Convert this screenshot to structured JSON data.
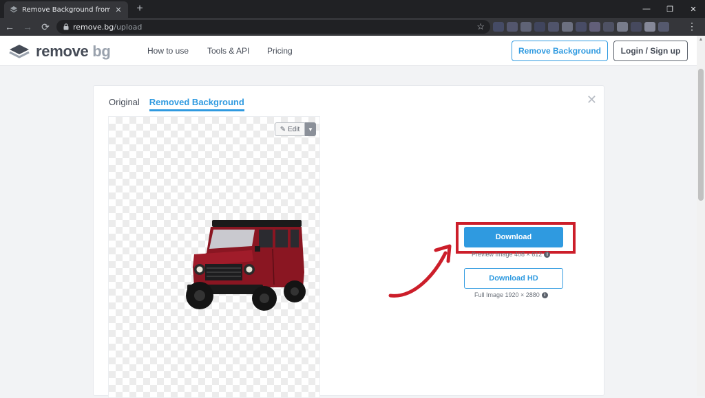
{
  "browser": {
    "tab_title": "Remove Background from Image",
    "tab_icon": "removebg-favicon",
    "url_domain": "remove.bg",
    "url_path": "/upload",
    "new_tab_glyph": "+",
    "close_tab_glyph": "✕"
  },
  "header": {
    "logo_remove": "remove",
    "logo_bg": "bg",
    "nav": [
      "How to use",
      "Tools & API",
      "Pricing"
    ],
    "remove_background_button": "Remove Background",
    "login_button": "Login / Sign up"
  },
  "editor": {
    "tabs": [
      "Original",
      "Removed Background"
    ],
    "active_tab": "Removed Background",
    "edit_label": "Edit",
    "download_label": "Download",
    "preview_label": "Preview Image 408 × 612",
    "download_hd_label": "Download HD",
    "full_label": "Full Image 1920 × 2880",
    "info_glyph": "i"
  },
  "colors": {
    "accent": "#2f9ae0",
    "highlight": "#cc1e2a",
    "vehicle": "#8a1622"
  }
}
